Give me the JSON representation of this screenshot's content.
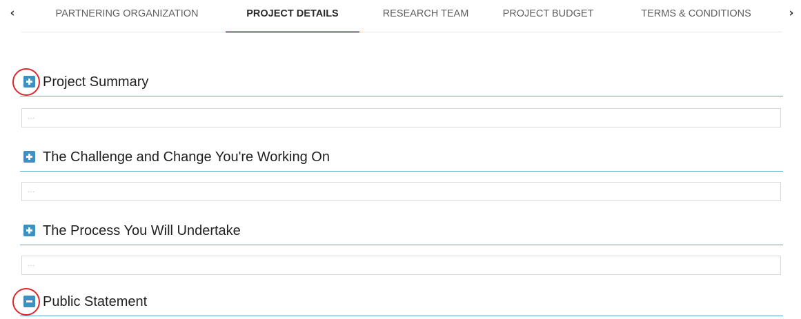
{
  "tabs": {
    "prev_icon": "chevron-left-icon",
    "next_icon": "chevron-right-icon",
    "prev_glyph": "‹",
    "next_glyph": "›",
    "items": [
      {
        "label": "PARTNERING ORGANIZATION",
        "active": false
      },
      {
        "label": "PROJECT DETAILS",
        "active": true
      },
      {
        "label": "RESEARCH TEAM",
        "active": false
      },
      {
        "label": "PROJECT BUDGET",
        "active": false
      },
      {
        "label": "TERMS & CONDITIONS",
        "active": false
      }
    ]
  },
  "sections": [
    {
      "title": "Project Summary",
      "state": "collapsed",
      "toggle_icon": "expand-plus-icon",
      "field_placeholder": "...",
      "annotated": true
    },
    {
      "title": "The Challenge and Change You're Working On",
      "state": "collapsed",
      "toggle_icon": "expand-plus-icon",
      "field_placeholder": "...",
      "annotated": false
    },
    {
      "title": "The Process You Will Undertake",
      "state": "collapsed",
      "toggle_icon": "expand-plus-icon",
      "field_placeholder": "...",
      "annotated": false
    },
    {
      "title": "Public Statement",
      "state": "expanded",
      "toggle_icon": "collapse-minus-icon",
      "annotated": true
    }
  ],
  "colors": {
    "accent": "#3d90bf",
    "divider": "#5aa4c6",
    "annotation": "#e0262c"
  }
}
